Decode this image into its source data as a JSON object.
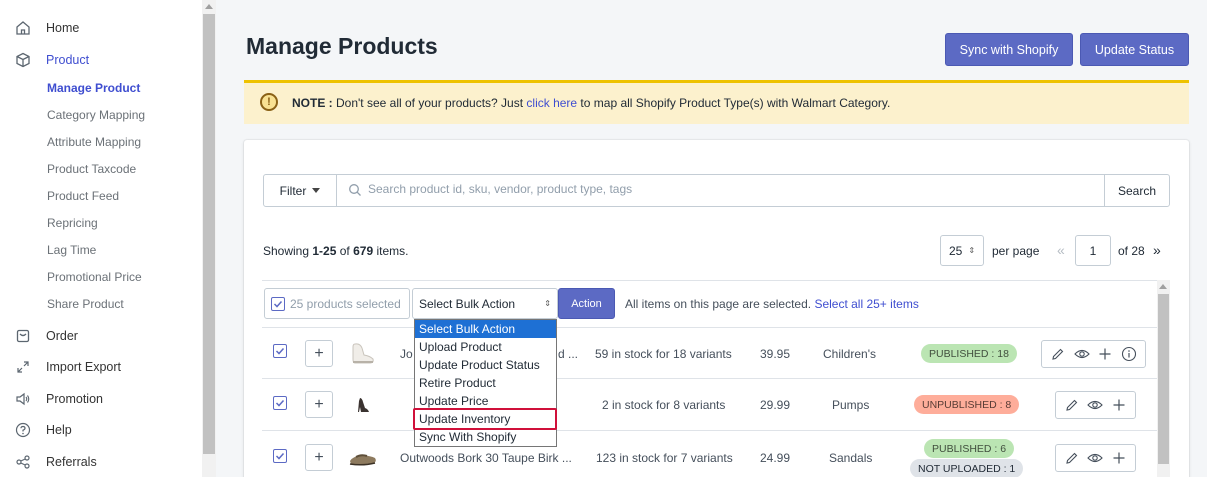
{
  "sidebar": {
    "items": [
      {
        "label": "Home",
        "icon": "home-icon"
      },
      {
        "label": "Product",
        "icon": "box-icon"
      },
      {
        "label": "Order",
        "icon": "order-icon"
      },
      {
        "label": "Import Export",
        "icon": "expand-arrows-icon"
      },
      {
        "label": "Promotion",
        "icon": "speaker-icon"
      },
      {
        "label": "Help",
        "icon": "question-icon"
      },
      {
        "label": "Referrals",
        "icon": "share-icon"
      }
    ],
    "product_subitems": [
      "Manage Product",
      "Category Mapping",
      "Attribute Mapping",
      "Product Taxcode",
      "Product Feed",
      "Repricing",
      "Lag Time",
      "Promotional Price",
      "Share Product"
    ],
    "active_subitem": "Manage Product"
  },
  "header": {
    "title": "Manage Products",
    "sync_button": "Sync with Shopify",
    "update_status_button": "Update Status"
  },
  "note": {
    "prefix": "NOTE :",
    "text_before": " Don't see all of your products? Just ",
    "link": "click here",
    "text_after": " to map all Shopify Product Type(s) with Walmart Category."
  },
  "filter": {
    "filter_label": "Filter",
    "search_placeholder": "Search product id, sku, vendor, product type, tags",
    "search_button": "Search"
  },
  "pagination": {
    "showing_prefix": "Showing ",
    "range": "1-25",
    "of_text": " of ",
    "total": "679",
    "suffix": " items.",
    "per_page_value": "25",
    "per_page_label": "per page",
    "prev": "«",
    "current_page": "1",
    "of_pages": "of 28",
    "next": "»"
  },
  "bulk": {
    "selected_text": "25 products selected",
    "select_value": "Select Bulk Action",
    "action_button": "Action",
    "all_selected_text": "All items on this page are selected. ",
    "select_all_link": "Select all 25+ items",
    "options": [
      "Select Bulk Action",
      "Upload Product",
      "Update Product Status",
      "Retire Product",
      "Update Price",
      "Update Inventory",
      "Sync With Shopify"
    ],
    "highlighted_option": "Update Inventory"
  },
  "rows": [
    {
      "name": "Jo",
      "name_tail": "d ...",
      "stock": "59 in stock for 18 variants",
      "price": "39.95",
      "type": "Children's",
      "badges": [
        {
          "text": "PUBLISHED : 18",
          "status": "published"
        }
      ],
      "actions": [
        "pencil-icon",
        "eye-icon",
        "plus-icon",
        "info-icon"
      ]
    },
    {
      "name": "",
      "name_tail": "",
      "stock": "2 in stock for 8 variants",
      "price": "29.99",
      "type": "Pumps",
      "badges": [
        {
          "text": "UNPUBLISHED : 8",
          "status": "unpublished"
        }
      ],
      "actions": [
        "pencil-icon",
        "eye-icon",
        "plus-icon"
      ]
    },
    {
      "name": "Outwoods Bork 30 Taupe Birk ...",
      "name_tail": "",
      "stock": "123 in stock for 7 variants",
      "price": "24.99",
      "type": "Sandals",
      "badges": [
        {
          "text": "PUBLISHED : 6",
          "status": "published"
        },
        {
          "text": "NOT UPLOADED : 1",
          "status": "not-uploaded"
        }
      ],
      "actions": [
        "pencil-icon",
        "eye-icon",
        "plus-icon"
      ]
    }
  ],
  "colors": {
    "primary": "#5c6ac4",
    "link": "#3f4ed0",
    "note_bg": "#fcf1cd",
    "highlight_border": "#d0103a",
    "published": "#bbe5b3",
    "unpublished": "#fead9a"
  }
}
